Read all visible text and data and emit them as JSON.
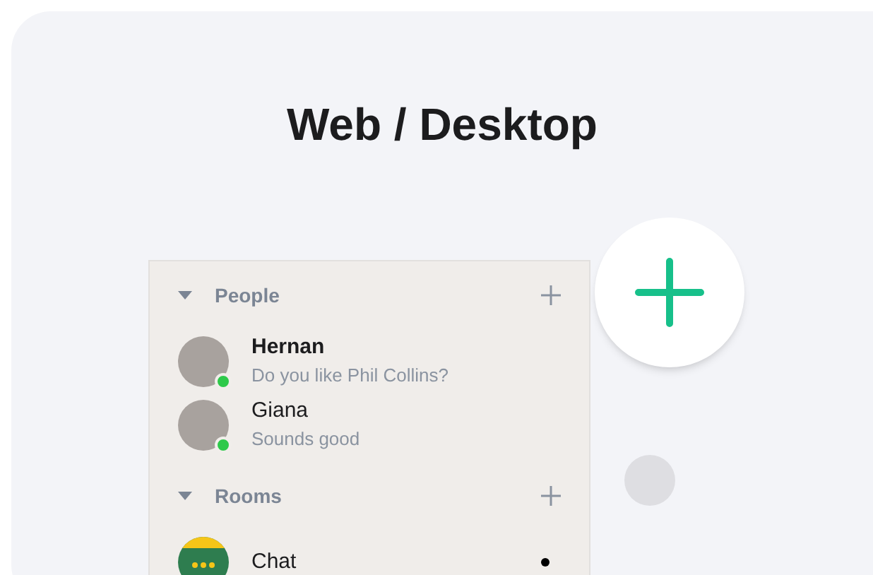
{
  "title": "Web / Desktop",
  "sections": [
    {
      "title": "People",
      "expanded": true,
      "items": [
        {
          "kind": "person",
          "name": "Hernan",
          "message": "Do you like Phil Collins?",
          "online": true,
          "emphasized": true
        },
        {
          "kind": "person",
          "name": "Giana",
          "message": "Sounds good",
          "online": true,
          "emphasized": false
        }
      ]
    },
    {
      "title": "Rooms",
      "expanded": true,
      "items": [
        {
          "kind": "room",
          "name": "Chat",
          "unread": true,
          "emphasized": false
        }
      ]
    }
  ]
}
